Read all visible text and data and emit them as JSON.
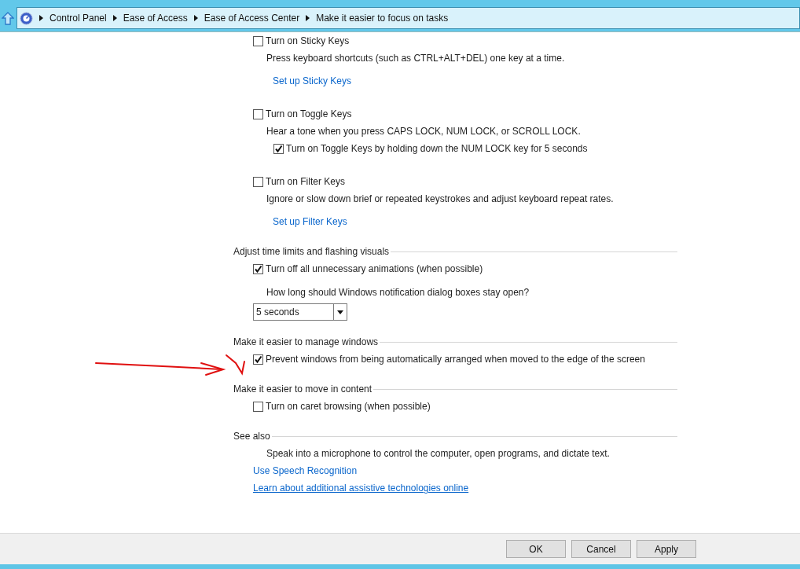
{
  "breadcrumb": [
    "Control Panel",
    "Ease of Access",
    "Ease of Access Center",
    "Make it easier to focus on tasks"
  ],
  "sections": [
    {
      "groups": [
        {
          "items": [
            {
              "kind": "checkbox",
              "label": "Turn on Sticky Keys",
              "checked": false
            },
            {
              "kind": "text",
              "text": "Press keyboard shortcuts (such as CTRL+ALT+DEL) one key at a time."
            },
            {
              "kind": "link",
              "text": "Set up Sticky Keys"
            }
          ]
        },
        {
          "items": [
            {
              "kind": "checkbox",
              "label": "Turn on Toggle Keys",
              "checked": false
            },
            {
              "kind": "text",
              "text": "Hear a tone when you press CAPS LOCK, NUM LOCK, or SCROLL LOCK."
            },
            {
              "kind": "subcheckbox",
              "label": "Turn on Toggle Keys by holding down the NUM LOCK key for 5 seconds",
              "checked": true
            }
          ]
        },
        {
          "items": [
            {
              "kind": "checkbox",
              "label": "Turn on Filter Keys",
              "checked": false
            },
            {
              "kind": "text",
              "text": "Ignore or slow down brief or repeated keystrokes and adjust keyboard repeat rates."
            },
            {
              "kind": "link",
              "text": "Set up Filter Keys"
            }
          ]
        }
      ]
    },
    {
      "heading": "Adjust time limits and flashing visuals",
      "groups": [
        {
          "items": [
            {
              "kind": "checkbox",
              "label": "Turn off all unnecessary animations (when possible)",
              "checked": true
            }
          ]
        },
        {
          "items": [
            {
              "kind": "text",
              "text": "How long should Windows notification dialog boxes stay open?"
            },
            {
              "kind": "dropdown",
              "value": "5 seconds"
            }
          ]
        }
      ]
    },
    {
      "heading": "Make it easier to manage windows",
      "groups": [
        {
          "items": [
            {
              "kind": "checkbox",
              "label": "Prevent windows from being automatically arranged when moved to the edge of the screen",
              "checked": true
            }
          ]
        }
      ]
    },
    {
      "heading": "Make it easier to move in content",
      "groups": [
        {
          "items": [
            {
              "kind": "checkbox",
              "label": "Turn on caret browsing (when possible)",
              "checked": false
            }
          ]
        }
      ]
    },
    {
      "heading": "See also",
      "groups": [
        {
          "items": [
            {
              "kind": "text",
              "text": "Speak into a microphone to control the computer, open programs, and dictate text."
            },
            {
              "kind": "link",
              "text": "Use Speech Recognition"
            },
            {
              "kind": "underlined_link",
              "text": "Learn about additional assistive technologies online"
            }
          ]
        }
      ]
    }
  ],
  "annotation": {
    "kind": "arrow"
  },
  "buttons": [
    "OK",
    "Cancel",
    "Apply"
  ]
}
